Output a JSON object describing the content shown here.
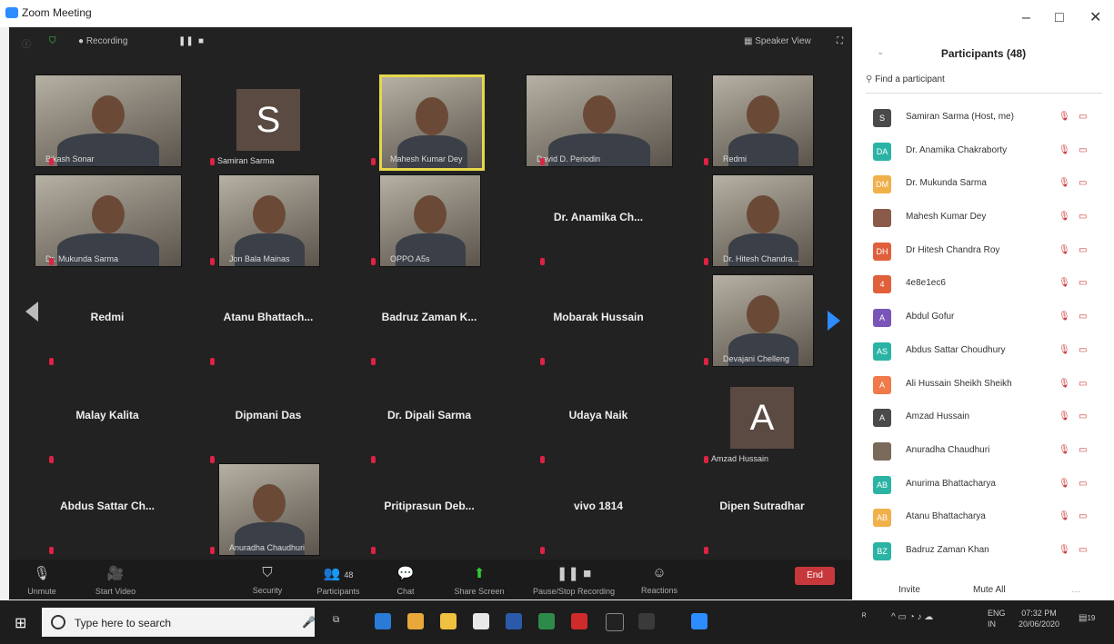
{
  "window": {
    "title": "Zoom Meeting"
  },
  "top_bar": {
    "recording": "Recording",
    "speaker_view": "Speaker View"
  },
  "grid": [
    {
      "name": "Bikash Sonar",
      "type": "photo"
    },
    {
      "name": "Samiran Sarma",
      "type": "letter",
      "letter": "S"
    },
    {
      "name": "Mahesh Kumar Dey",
      "type": "photo",
      "active": true
    },
    {
      "name": "David D. Periodin",
      "type": "photo"
    },
    {
      "name": "Redmi",
      "type": "photo"
    },
    {
      "name": "Dr. Mukunda Sarma",
      "type": "photo"
    },
    {
      "name": "Jon Bala Mainas",
      "type": "photo"
    },
    {
      "name": "OPPO A5s",
      "type": "photo"
    },
    {
      "name": "Dr. Anamika Ch...",
      "type": "name"
    },
    {
      "name": "Dr. Hitesh Chandra...",
      "type": "photo"
    },
    {
      "name": "Redmi",
      "type": "name"
    },
    {
      "name": "Atanu Bhattach...",
      "type": "name"
    },
    {
      "name": "Badruz Zaman K...",
      "type": "name"
    },
    {
      "name": "Mobarak Hussain",
      "type": "name"
    },
    {
      "name": "Devajani Chelleng",
      "type": "photo"
    },
    {
      "name": "Malay Kalita",
      "type": "name"
    },
    {
      "name": "Dipmani Das",
      "type": "name"
    },
    {
      "name": "Dr. Dipali Sarma",
      "type": "name"
    },
    {
      "name": "Udaya Naik",
      "type": "name"
    },
    {
      "name": "Amzad Hussain",
      "type": "letter",
      "letter": "A"
    },
    {
      "name": "Abdus Sattar Ch...",
      "type": "name"
    },
    {
      "name": "Anuradha Chaudhuri",
      "type": "photo"
    },
    {
      "name": "Pritiprasun Deb...",
      "type": "name"
    },
    {
      "name": "vivo 1814",
      "type": "name"
    },
    {
      "name": "Dipen Sutradhar",
      "type": "name"
    }
  ],
  "toolbar": {
    "unmute": "Unmute",
    "start_video": "Start Video",
    "security": "Security",
    "participants": "Participants",
    "participants_count": "48",
    "chat": "Chat",
    "share_screen": "Share Screen",
    "pause_recording": "Pause/Stop Recording",
    "reactions": "Reactions",
    "end": "End"
  },
  "panel": {
    "title": "Participants (48)",
    "search_placeholder": "Find a participant",
    "participants": [
      {
        "name": "Samiran Sarma (Host, me)",
        "initials": "S",
        "color": "#4a4a4a"
      },
      {
        "name": "Dr. Anamika Chakraborty",
        "initials": "DA",
        "color": "#2bb3a3"
      },
      {
        "name": "Dr. Mukunda Sarma",
        "initials": "DM",
        "color": "#f0b04a"
      },
      {
        "name": "Mahesh Kumar Dey",
        "initials": "",
        "color": "#8a5a4a"
      },
      {
        "name": "Dr Hitesh Chandra Roy",
        "initials": "DH",
        "color": "#e0603c"
      },
      {
        "name": "4e8e1ec6",
        "initials": "4",
        "color": "#e0603c"
      },
      {
        "name": "Abdul Gofur",
        "initials": "A",
        "color": "#7a55b8"
      },
      {
        "name": "Abdus Sattar Choudhury",
        "initials": "AS",
        "color": "#2bb3a3"
      },
      {
        "name": "Ali Hussain Sheikh Sheikh",
        "initials": "A",
        "color": "#f07a4a"
      },
      {
        "name": "Amzad Hussain",
        "initials": "A",
        "color": "#4a4a4a"
      },
      {
        "name": "Anuradha Chaudhuri",
        "initials": "",
        "color": "#7a6a5a"
      },
      {
        "name": "Anurima Bhattacharya",
        "initials": "AB",
        "color": "#2bb3a3"
      },
      {
        "name": "Atanu Bhattacharya",
        "initials": "AB",
        "color": "#f0b04a"
      },
      {
        "name": "Badruz Zaman Khan",
        "initials": "BZ",
        "color": "#2bb3a3"
      }
    ],
    "invite": "Invite",
    "mute_all": "Mute All"
  },
  "taskbar": {
    "search_placeholder": "Type here to search",
    "lang": "ENG",
    "lang2": "IN",
    "time": "07:32 PM",
    "date": "20/06/2020",
    "notifications": "19"
  }
}
